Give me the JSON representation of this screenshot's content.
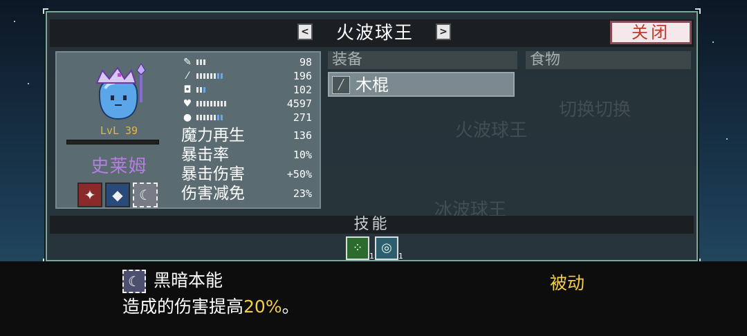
{
  "title": "火波球王",
  "close_label": "关闭",
  "nav": {
    "prev_symbol": "<",
    "next_symbol": ">"
  },
  "character": {
    "level": "LvL 39",
    "name": "史莱姆",
    "stats": [
      {
        "icon": "sword-icon",
        "glyph": "✎",
        "value": "98"
      },
      {
        "icon": "wand-icon",
        "glyph": "⁄",
        "value": "196"
      },
      {
        "icon": "shield-icon",
        "glyph": "◘",
        "value": "102"
      },
      {
        "icon": "heart-icon",
        "glyph": "♥",
        "value": "4597"
      },
      {
        "icon": "drop-icon",
        "glyph": "●",
        "value": "271"
      }
    ],
    "attributes": [
      {
        "label": "魔力再生",
        "value": "136"
      },
      {
        "label": "暴击率",
        "value": "10%"
      },
      {
        "label": "暴击伤害",
        "value": "+50%"
      },
      {
        "label": "伤害减免",
        "value": "23%"
      }
    ]
  },
  "equipment": {
    "header": "装备",
    "items": [
      {
        "icon": "staff-icon",
        "name": "木棍"
      }
    ]
  },
  "food": {
    "header": "食物"
  },
  "skills": {
    "header": "技能",
    "slots": [
      {
        "icon": "spark-icon",
        "count": "1"
      },
      {
        "icon": "vortex-icon",
        "count": "1"
      }
    ]
  },
  "tooltip": {
    "name": "黑暗本能",
    "type": "被动",
    "desc_prefix": "造成的伤害提高",
    "desc_value": "20%",
    "desc_suffix": "。"
  },
  "colors": {
    "name": "#b57fe0",
    "level": "#e8b83a",
    "highlight": "#f2cf45",
    "close_text": "#c0392b"
  }
}
